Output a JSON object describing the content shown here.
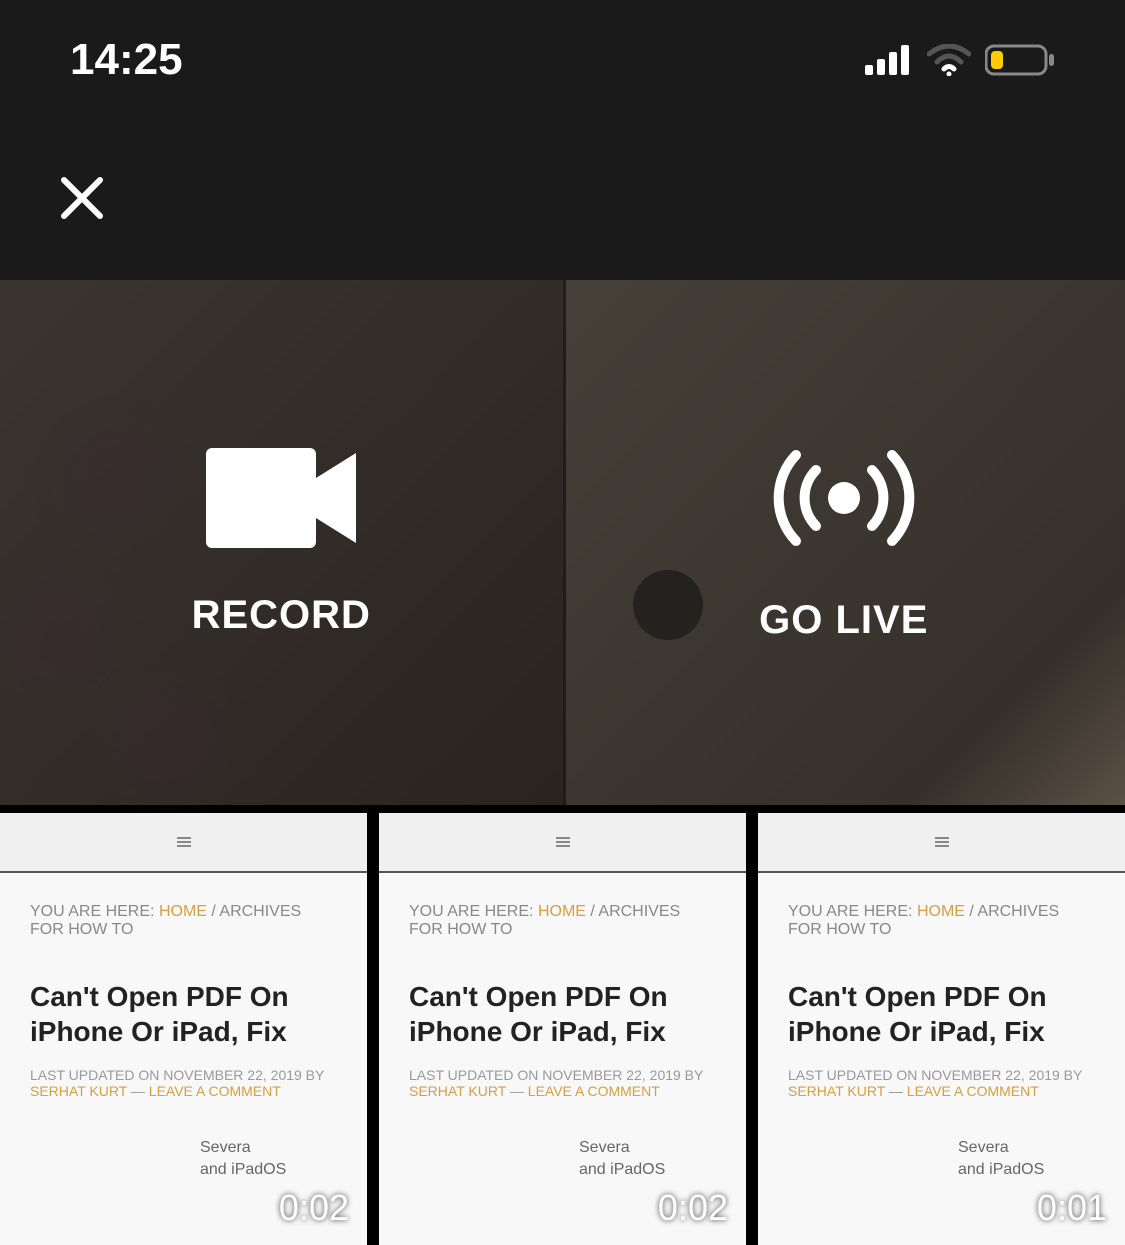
{
  "status": {
    "time": "14:25"
  },
  "actions": {
    "record_label": "RECORD",
    "golive_label": "GO LIVE"
  },
  "thumb_common": {
    "breadcrumb_prefix": "YOU ARE HERE:",
    "breadcrumb_home": "HOME",
    "breadcrumb_tail": "/ ARCHIVES FOR HOW TO",
    "title": "Can't Open PDF On iPhone Or iPad, Fix",
    "meta_date": "LAST UPDATED ON NOVEMBER 22, 2019 BY",
    "author": "SERHAT KURT",
    "dash": " — ",
    "comment": "LEAVE A COMMENT",
    "body_line1": "Severa",
    "body_line2": "and iPadOS"
  },
  "thumbs": [
    {
      "duration": "0:02"
    },
    {
      "duration": "0:02"
    },
    {
      "duration": "0:01"
    }
  ]
}
